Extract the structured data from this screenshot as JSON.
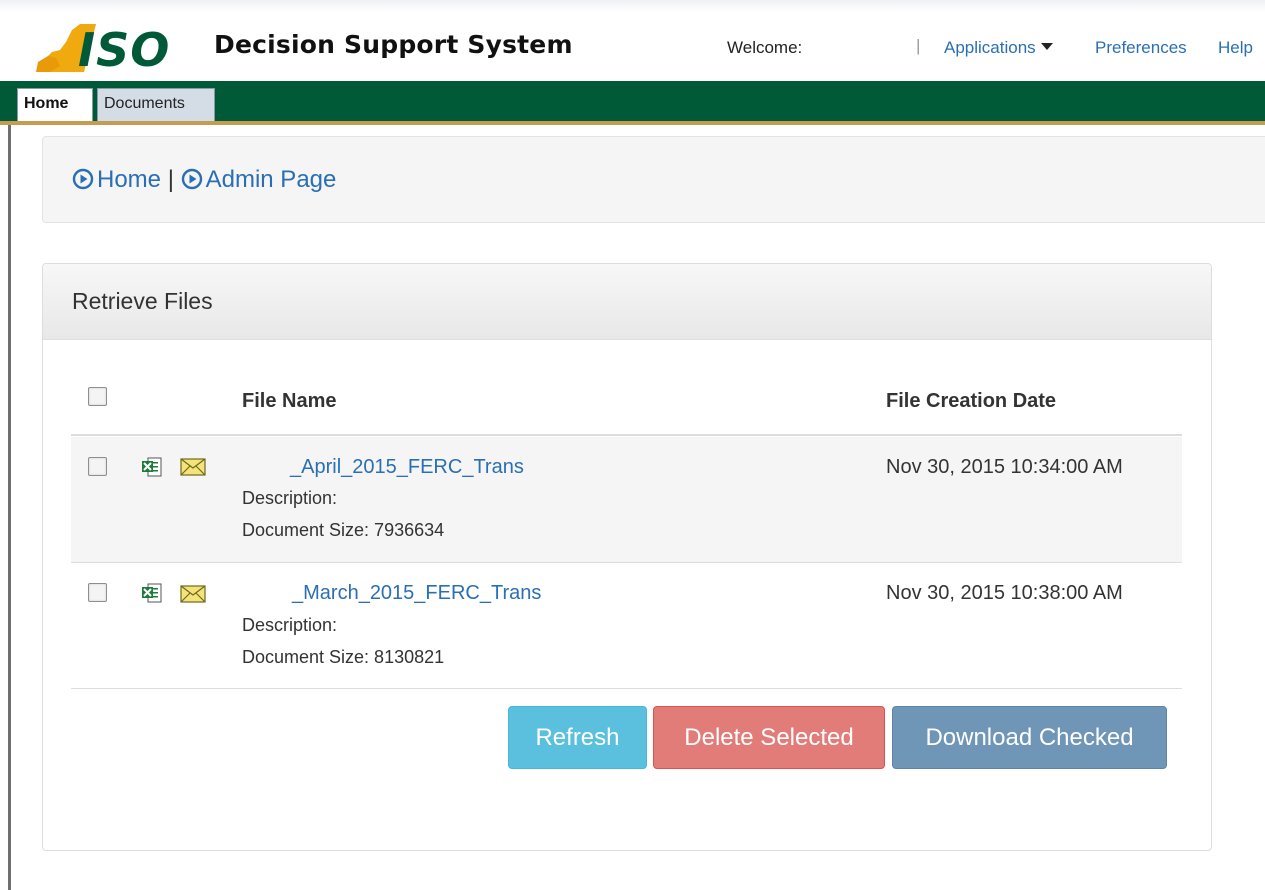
{
  "header": {
    "app_title": "Decision Support System",
    "welcome": "Welcome:",
    "separator": "|",
    "nav": {
      "applications": "Applications",
      "preferences": "Preferences",
      "help": "Help"
    }
  },
  "tabs": [
    {
      "label": "Home",
      "active": true
    },
    {
      "label": "Documents",
      "active": false
    }
  ],
  "breadcrumb": {
    "home": "Home",
    "divider": "|",
    "admin": "Admin Page"
  },
  "files_panel": {
    "title": "Retrieve Files",
    "columns": {
      "file_name": "File Name",
      "creation_date": "File Creation Date"
    },
    "rows": [
      {
        "file_name": "_April_2015_FERC_Trans",
        "description_label": "Description:",
        "size_label": "Document Size: 7936634",
        "created": "Nov 30, 2015 10:34:00 AM"
      },
      {
        "file_name": "_March_2015_FERC_Trans",
        "description_label": "Description:",
        "size_label": "Document Size: 8130821",
        "created": "Nov 30, 2015 10:38:00 AM"
      }
    ],
    "buttons": {
      "refresh": "Refresh",
      "delete": "Delete Selected",
      "download": "Download Checked"
    }
  },
  "colors": {
    "brand_green": "#005a37",
    "accent_gold": "#c69c52",
    "link_blue": "#2a6fb5"
  },
  "icons": [
    "nyiso-logo",
    "caret-down-icon",
    "circle-arrow-icon",
    "excel-file-icon",
    "email-icon"
  ]
}
